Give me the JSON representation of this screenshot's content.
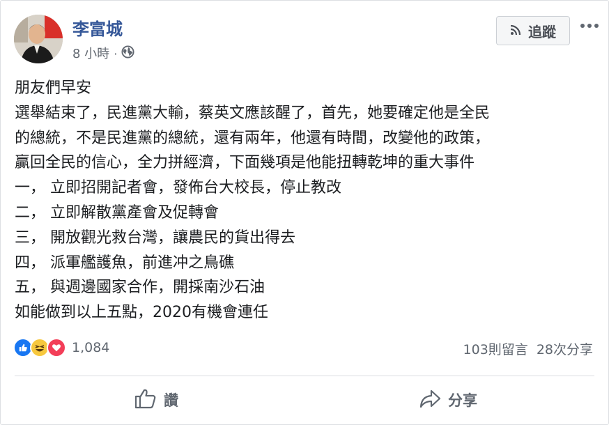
{
  "post": {
    "author": "李富城",
    "time": "8 小時",
    "separator": "·",
    "privacy_icon": "globe-icon",
    "follow_label": "追蹤",
    "text_lines": [
      "朋友們早安",
      "選舉結束了，民進黨大輸，蔡英文應該醒了，首先，她要確定他是全民",
      "的總統，不是民進黨的總統，還有兩年，他還有時間，改變他的政策，",
      "贏回全民的信心，全力拼經濟，下面幾項是他能扭轉乾坤的重大事件",
      "一， 立即招開記者會，發佈台大校長，停止教改",
      "二， 立即解散黨產會及促轉會",
      "三， 開放觀光救台灣，讓農民的貨出得去",
      "四， 派軍艦護魚，前進冲之鳥礁",
      "五， 與週邊國家合作，開採南沙石油",
      "如能做到以上五點，2020有機會連任"
    ]
  },
  "engagement": {
    "reaction_count": "1,084",
    "comments": "103則留言",
    "shares": "28次分享"
  },
  "actions": {
    "like_label": "讚",
    "share_label": "分享"
  },
  "colors": {
    "name_blue": "#365899",
    "like_blue": "#1877f2",
    "haha_yellow": "#f7c83e",
    "love_red": "#f33e58"
  }
}
